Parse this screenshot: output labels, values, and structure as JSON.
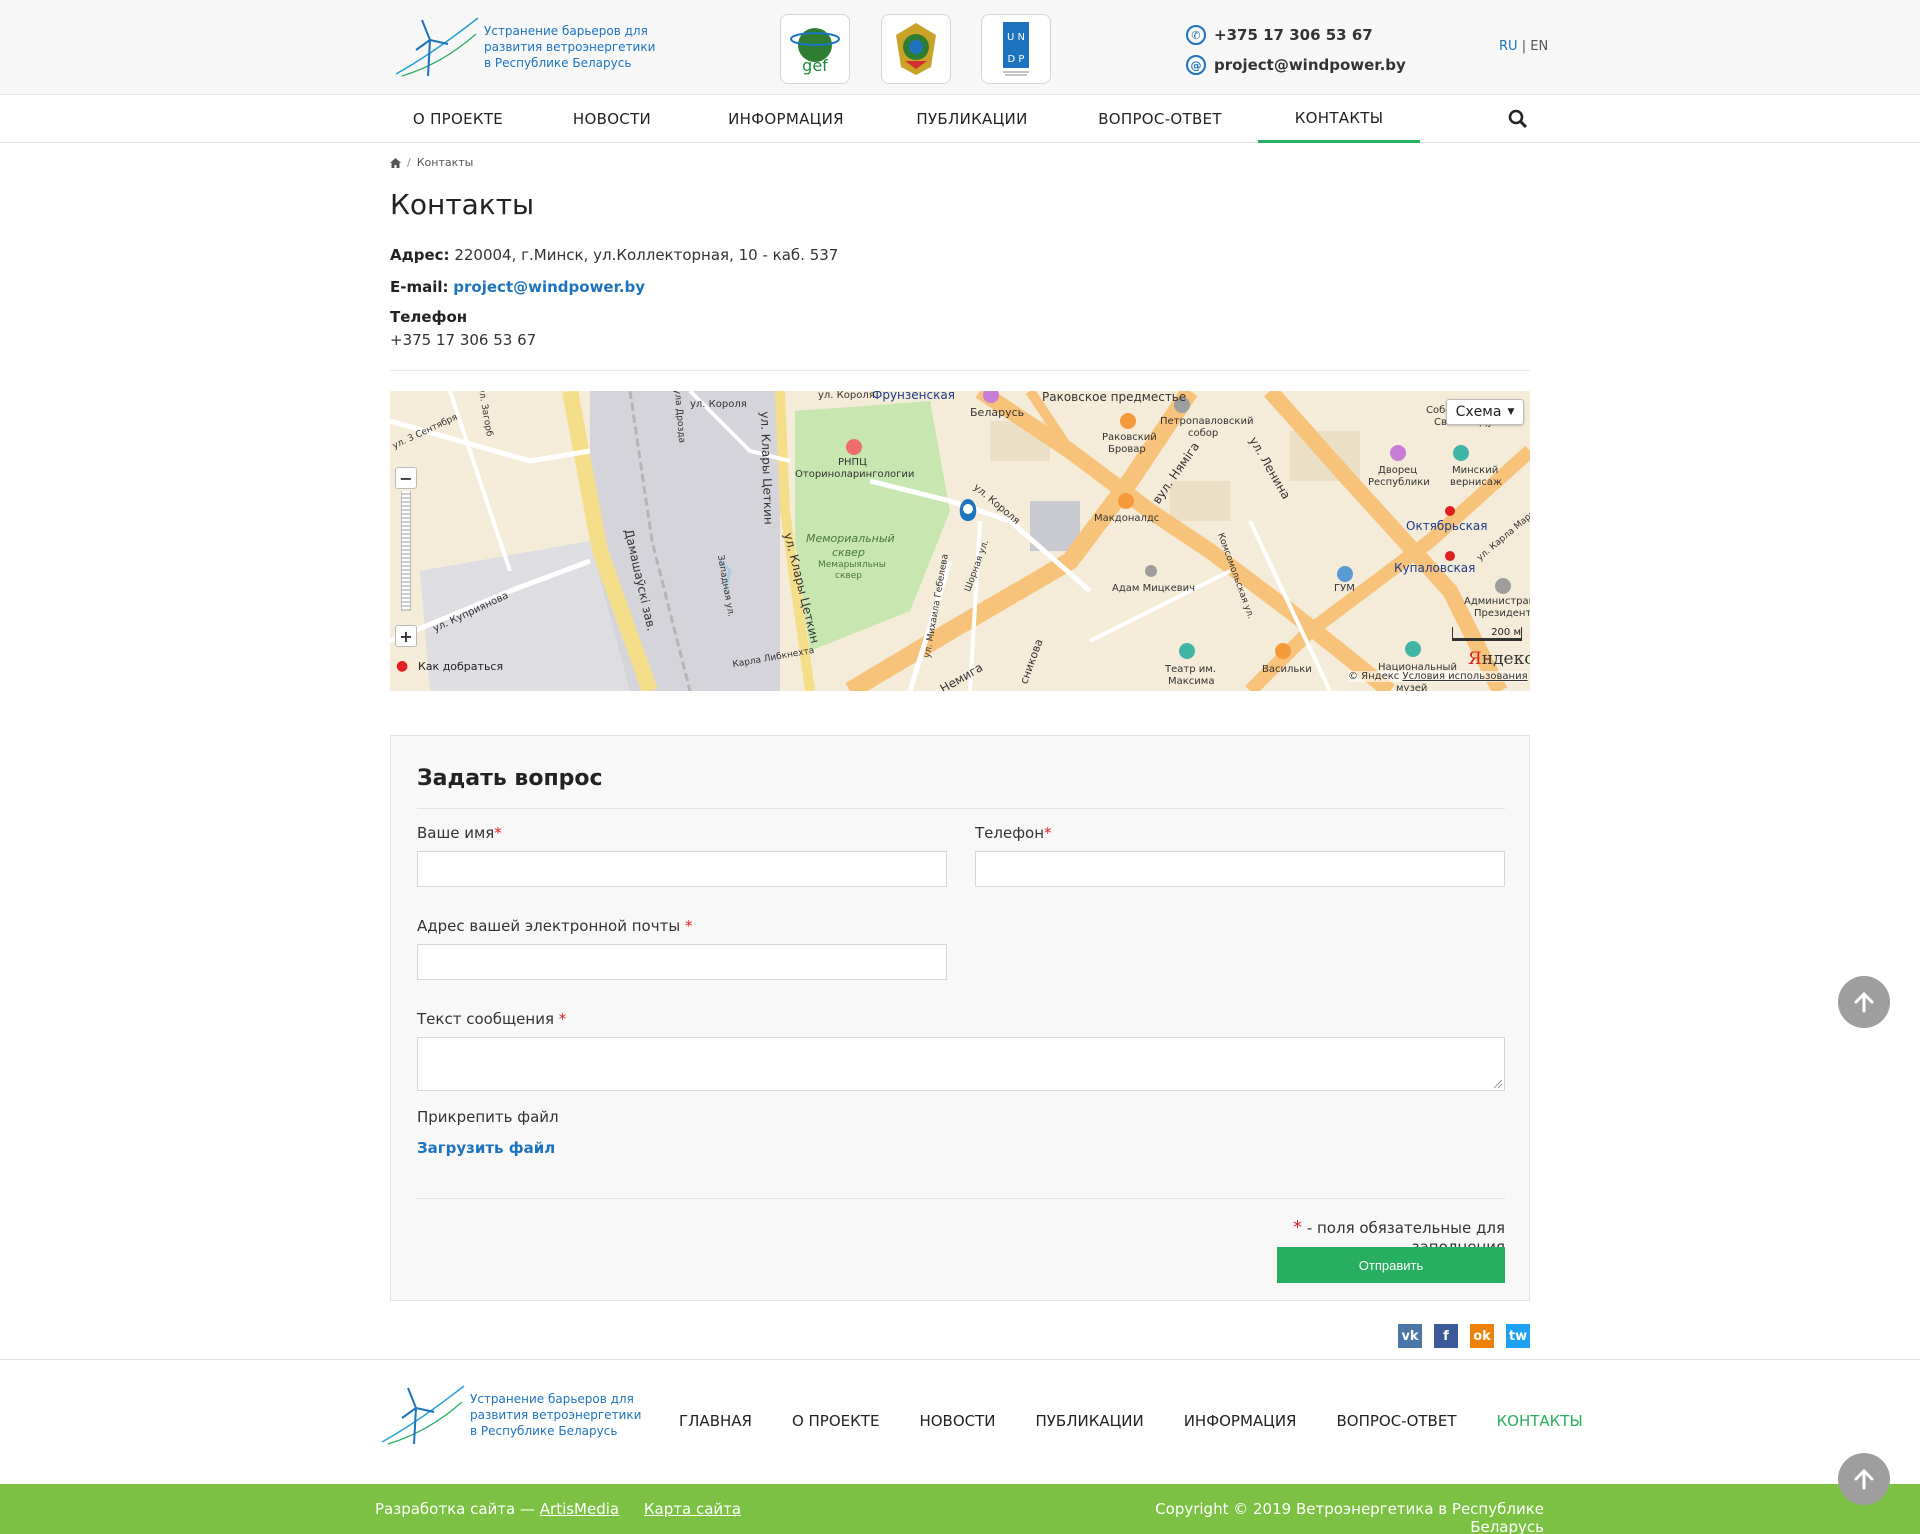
{
  "header": {
    "logo_lines": [
      "Устранение барьеров для",
      "развития ветроэнергетики",
      "в Республике Беларусь"
    ],
    "partners": [
      "gef",
      "coat-of-arms",
      "UNDP"
    ],
    "phone": "+375 17 306 53 67",
    "email": "project@windpower.by",
    "lang_ru": "RU",
    "lang_sep": "|",
    "lang_en": "EN"
  },
  "nav": {
    "items": [
      "О ПРОЕКТЕ",
      "НОВОСТИ",
      "ИНФОРМАЦИЯ",
      "ПУБЛИКАЦИИ",
      "ВОПРОС-ОТВЕТ",
      "КОНТАКТЫ"
    ],
    "active": "КОНТАКТЫ"
  },
  "breadcrumb": {
    "sep": "/",
    "current": "Контакты"
  },
  "page": {
    "title": "Контакты",
    "address_label": "Адрес:",
    "address_value": "220004, г.Минск, ул.Коллекторная, 10 - каб. 537",
    "email_label": "E-mail:",
    "email_value": "project@windpower.by",
    "phone_label": "Телефон",
    "phone_value": "+375 17 306 53 67"
  },
  "map": {
    "schema_label": "Схема",
    "zoom_out": "−",
    "zoom_in": "+",
    "route_label": "Как добраться",
    "scale_label": "200 м",
    "copyright": "© Яндекс",
    "terms": "Условия использования",
    "brand_y": "Я",
    "brand_rest": "ндекс",
    "labels": {
      "frunzenskaya": "Фрунзенская",
      "rakovskoe": "Раковское предместье",
      "belarus": "Беларусь",
      "rnpc1": "РНПЦ",
      "rnpc2": "Оториноларингологии",
      "rakovsky1": "Раковский",
      "rakovsky2": "Бровар",
      "petro1": "Петропавловский",
      "petro2": "собор",
      "sobor1": "Собор Сошествия",
      "sobor2": "Святого Духа",
      "dvorec1": "Дворец",
      "dvorec2": "Республики",
      "minsky1": "Минский",
      "minsky2": "вернисаж",
      "memorial1": "Мемориальный",
      "memorial2": "сквер",
      "memorial3": "Мемарыяльны",
      "memorial4": "сквер",
      "makdonalds": "Макдоналдс",
      "oktyabrskaya": "Октябрьская",
      "kupalovskaya": "Купаловская",
      "adam": "Адам Мицкевич",
      "gum": "ГУМ",
      "admin1": "Администрац",
      "admin2": "Президента",
      "teatr1": "Театр им.",
      "teatr2": "Максима",
      "vasilki": "Васильки",
      "nacional": "Национальный",
      "muzey": "музей",
      "st_korolya": "ул. Короля",
      "st_korolya2": "ул. Короля",
      "st_korolya3": "ул. Короля",
      "st_klary": "ул. Клары Цеткин",
      "st_klary2": "ул. Клары Цеткин",
      "st_damash": "Дамашаўскі зав.",
      "st_nemiga": "вул. Няміга",
      "st_nemiga2": "Немига",
      "st_lenina": "ул. Ленина",
      "st_kuprianova": "ул. Куприянова",
      "st_3sent": "ул. 3 Сентября",
      "st_zagor": "ул. Загорб",
      "st_drozda": "ула Дрозда",
      "st_zapadnaya": "Западная ул.",
      "st_shornaya": "Шорная ул.",
      "st_gebeleva": "ул. Михаила Гебелева",
      "st_libknehta": "Карла Либкнехта",
      "st_komsom": "Комсомольская ул.",
      "st_karla": "ул. Карла Марк",
      "st_sovnikova": "сникова"
    }
  },
  "form": {
    "title": "Задать вопрос",
    "name_label": "Ваше имя",
    "phone_label": "Телефон",
    "email_label": "Адрес вашей электронной почты",
    "message_label": "Текст сообщения",
    "req_mark": "*",
    "attach_label": "Прикрепить файл",
    "upload_label": "Загрузить файл",
    "req_note": "- поля обязательные для заполнения",
    "submit_label": "Отправить"
  },
  "social": [
    "vk",
    "f",
    "ok",
    "tw"
  ],
  "footer": {
    "nav": [
      "ГЛАВНАЯ",
      "О ПРОЕКТЕ",
      "НОВОСТИ",
      "ПУБЛИКАЦИИ",
      "ИНФОРМАЦИЯ",
      "ВОПРОС-ОТВЕТ",
      "КОНТАКТЫ"
    ],
    "active": "КОНТАКТЫ",
    "dev_prefix": "Разработка сайта — ",
    "dev_link": "ArtisMedia",
    "sitemap": "Карта сайта",
    "copyright": "Copyright © 2019 Ветроэнергетика в Республике Беларусь"
  },
  "colors": {
    "accent_green": "#27ae60",
    "link_blue": "#1e73be",
    "footer_green": "#7cc143",
    "required_red": "#e02020"
  }
}
